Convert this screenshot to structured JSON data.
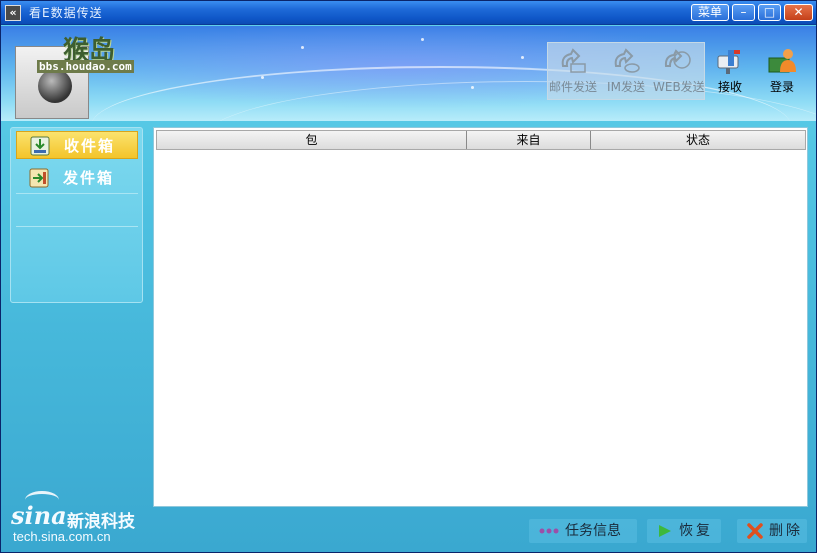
{
  "window": {
    "title": "看E数据传送",
    "menu_label": "菜单",
    "minimize_glyph": "–",
    "maximize_glyph": "□",
    "close_glyph": "✕"
  },
  "watermark": {
    "brand": "猴岛",
    "url": "bbs.houdao.com"
  },
  "toolbar": {
    "actions": [
      {
        "label": "邮件发送",
        "icon": "mail-send-icon",
        "enabled": false
      },
      {
        "label": "IM发送",
        "icon": "im-send-icon",
        "enabled": false
      },
      {
        "label": "WEB发送",
        "icon": "web-send-icon",
        "enabled": false
      },
      {
        "label": "接收",
        "icon": "receive-icon",
        "enabled": true
      },
      {
        "label": "登录",
        "icon": "login-icon",
        "enabled": true
      }
    ]
  },
  "sidebar": {
    "items": [
      {
        "label": "收件箱",
        "icon": "inbox-icon",
        "active": true
      },
      {
        "label": "发件箱",
        "icon": "outbox-icon",
        "active": false
      }
    ]
  },
  "table": {
    "columns": [
      "包",
      "来自",
      "状态"
    ],
    "rows": []
  },
  "footer": {
    "sina_word": "sina",
    "sina_cn": "新浪科技",
    "sina_url": "tech.sina.com.cn",
    "buttons": [
      {
        "label": "任务信息",
        "icon": "task-info-icon"
      },
      {
        "label": "恢复",
        "icon": "restore-icon"
      },
      {
        "label": "删除",
        "icon": "delete-icon"
      }
    ]
  },
  "colors": {
    "titlebar": "#0f57c8",
    "accent_active": "#f3c42a",
    "panel_bg": "#4dc0e0"
  }
}
